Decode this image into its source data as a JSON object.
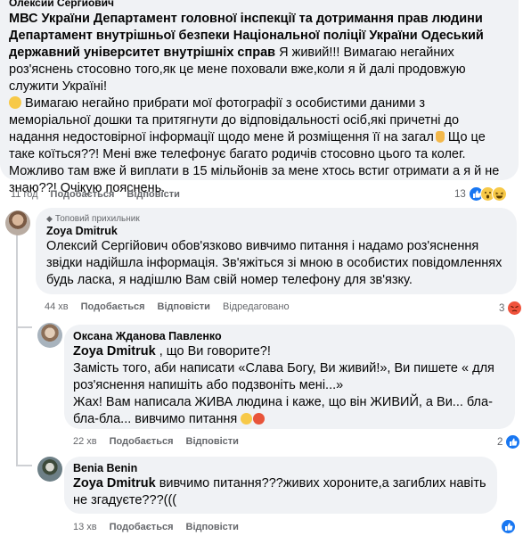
{
  "post": {
    "author": "Олексий Сергиович",
    "mentions": "МВС України Департамент головної інспекції та дотримання прав людини Департамент внутрішньої безпеки Національної поліції України Одеський державний університет внутрішніх справ",
    "line1_rest": " Я живий!!! Вимагаю негайних роз'яснень стосовно того,як це мене поховали вже,коли я й далі продовжую служити Україні!",
    "line2": " Вимагаю негайно прибрати мої фотографії з особистими даними з меморіальної дошки та притягнути до відповідальності осіб,які причетні до надання недостовірної інформації щодо мене й розміщення її на загал",
    "line3": " Що це таке коїться??! Мені вже телефонує багато родичів стосовно цього та колег. Можливо там вже й виплати в 15 мільйонів за мене хтось встиг отримати а я й не знаю??! Очікую пояснень.",
    "time": "11 год",
    "like_label": "Подобається",
    "reply_label": "Відповісти",
    "reaction_count": "13"
  },
  "comments": [
    {
      "badge": "Топовий прихильник",
      "author": "Zoya Dmitruk",
      "text": "Олексий Сергійович обов'язково вивчимо питання і надамо роз'яснення звідки надійшла інформація. Зв'яжіться зі мною в особистих повідомленнях будь ласка, я надішлю Вам свій номер телефону для зв'язку.",
      "time": "44 хв",
      "like_label": "Подобається",
      "reply_label": "Відповісти",
      "edited_label": "Відредаговано",
      "reaction_count": "3"
    },
    {
      "author": "Оксана Жданова Павленко",
      "mention": "Zoya Dmitruk",
      "text_p1": " , що Ви говорите?!",
      "text_p2": "Замість того, аби написати «Слава Богу, Ви живий!», Ви пишете « для роз'яснення напишіть або подзвоніть мені...»",
      "text_p3": "Жах! Вам написала ЖИВА людина і каже, що він ЖИВИЙ, а Ви... бла-бла-бла... вивчимо питання",
      "time": "22 хв",
      "like_label": "Подобається",
      "reply_label": "Відповісти",
      "reaction_count": "2"
    },
    {
      "author": "Benia Benin",
      "mention": "Zoya Dmitruk",
      "text": " вивчимо питання???живих хороните,а загиблих навіть не згадуєте???(((",
      "time": "13 хв",
      "like_label": "Подобається",
      "reply_label": "Відповісти"
    }
  ],
  "colors": {
    "bubble": "#f0f2f5",
    "meta": "#65676b",
    "like_blue": "#1877f2",
    "angry": "#f0533c"
  }
}
